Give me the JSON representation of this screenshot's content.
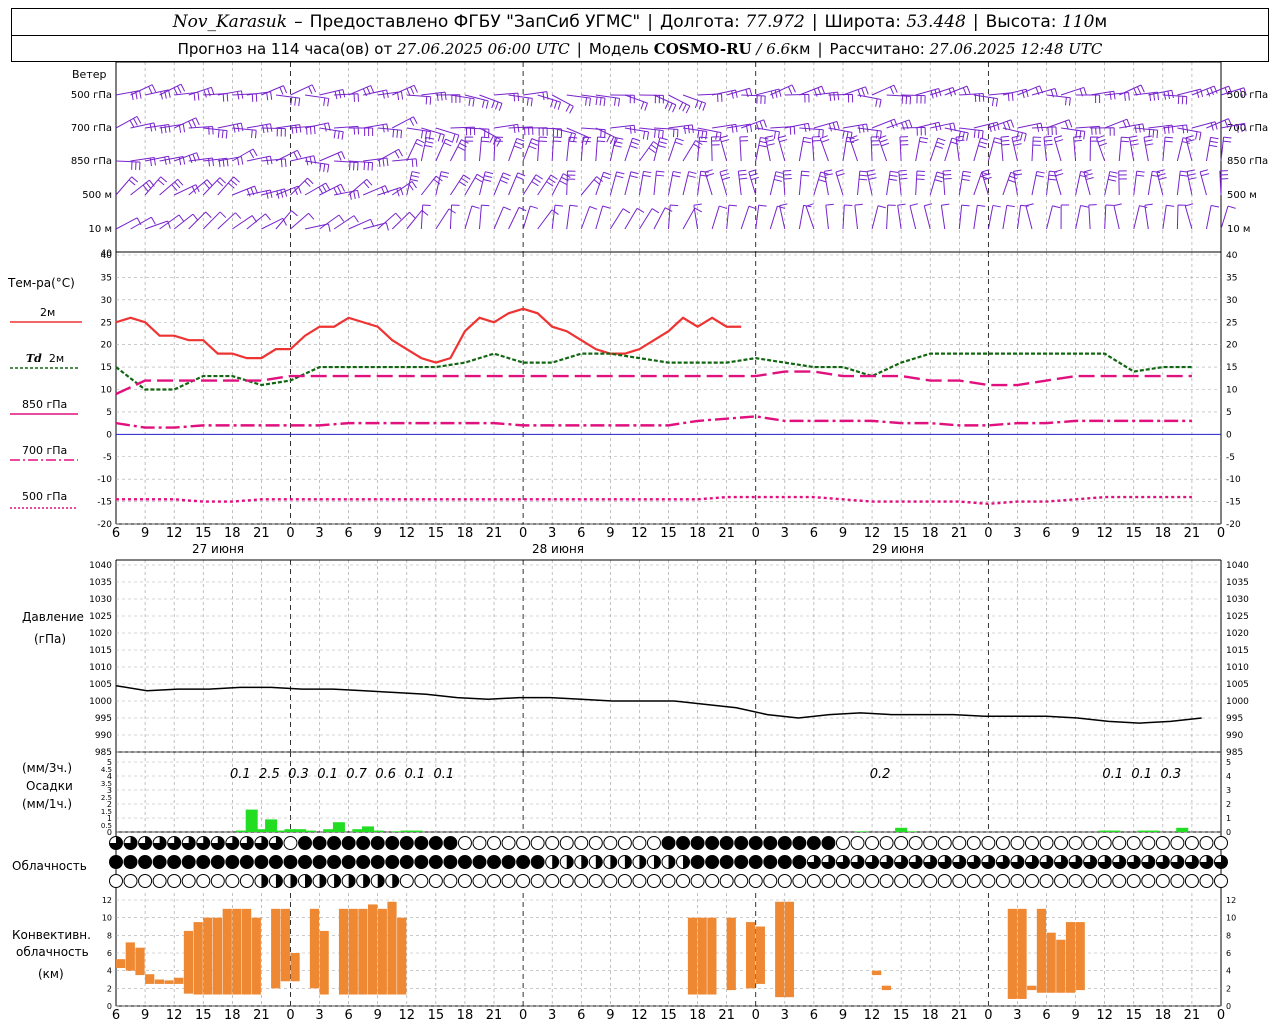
{
  "header": {
    "station": "Nov_Karasuk",
    "provider": "Предоставлено ФГБУ \"ЗапСиб УГМС\"",
    "longitude_label": "Долгота:",
    "longitude": "77.972",
    "latitude_label": "Широта:",
    "latitude": "53.448",
    "altitude_label": "Высота:",
    "altitude": "110",
    "altitude_unit": "м",
    "forecast_label": "Прогноз на 114 часа(ов) от",
    "forecast_start": "27.06.2025 06:00 UTC",
    "model_label": "Модель",
    "model": "COSMO-RU",
    "resolution": "/ 6.6",
    "resolution_unit": "км",
    "computed_label": "Рассчитано:",
    "computed": "27.06.2025 12:48 UTC"
  },
  "labels": {
    "wind": "Ветер",
    "wind_levels": [
      "500 гПа",
      "700 гПа",
      "850 гПа",
      "500 м",
      "10 м"
    ],
    "temp": "Тем-ра(°С)",
    "t2m": "2м",
    "td_italic": "Td",
    "td_rest": "2м",
    "t850": "850 гПа",
    "t700": "700 гПа",
    "t500": "500 гПа",
    "pressure": "Давление",
    "pressure_unit": "(гПа)",
    "precip_unit1": "(мм/3ч.)",
    "precip": "Осадки",
    "precip_unit2": "(мм/1ч.)",
    "clouds": "Облачность",
    "conv1": "Конвективн.",
    "conv2": "облачность",
    "conv3": "(км)"
  },
  "colors": {
    "t2m": "#ee3333",
    "td": "#116611",
    "t850": "#e0117f",
    "t700": "#e0117f",
    "t500": "#e0117f",
    "wind": "#7722cc",
    "zero_line": "#2222cc",
    "pressure": "#000000",
    "precip": "#22dd22",
    "conv": "#ee8833"
  },
  "chart_data": [
    {
      "type": "line",
      "title": "Тем-ра(°С)",
      "x_hours": [
        0,
        3,
        6,
        9,
        12,
        15,
        18,
        21,
        24,
        27,
        30,
        33,
        36,
        39,
        42,
        45,
        48,
        51,
        54,
        57,
        60,
        63,
        66,
        69,
        72,
        75,
        78,
        81,
        84,
        87,
        90,
        93,
        96,
        99,
        102,
        105,
        108,
        111,
        114
      ],
      "x_tick_labels": [
        "6",
        "9",
        "12",
        "15",
        "18",
        "21",
        "0",
        "3",
        "6",
        "9",
        "12",
        "15",
        "18",
        "21",
        "0",
        "3",
        "6",
        "9",
        "12",
        "15",
        "18",
        "21",
        "0",
        "3",
        "6",
        "9",
        "12",
        "15",
        "18",
        "21",
        "0",
        "3",
        "6",
        "9",
        "12",
        "15",
        "18",
        "21",
        "0",
        "3",
        "6",
        "9",
        "12"
      ],
      "date_labels": [
        "27 июня",
        "28 июня",
        "29 июня"
      ],
      "ylim": [
        -20,
        40
      ],
      "series": [
        {
          "name": "2м",
          "values": [
            25,
            26,
            25,
            22,
            22,
            21,
            21,
            18,
            18,
            17,
            17,
            19,
            19,
            22,
            24,
            24,
            26,
            25,
            24,
            21,
            19,
            17,
            16,
            17,
            23,
            26,
            25,
            27,
            28,
            27,
            24,
            23,
            21,
            19,
            18,
            18,
            19,
            21,
            23,
            26,
            24,
            26,
            24,
            24
          ],
          "dx": 1.5
        },
        {
          "name": "Td 2м",
          "values": [
            15,
            10,
            10,
            13,
            13,
            11,
            12,
            15,
            15,
            15,
            15,
            15,
            16,
            18,
            16,
            16,
            18,
            18,
            17,
            16,
            16,
            16,
            17,
            16,
            15,
            15,
            13,
            16,
            18,
            18,
            18,
            18,
            18,
            18,
            18,
            14,
            15,
            15
          ],
          "dx": 3
        },
        {
          "name": "850 гПа",
          "values": [
            9,
            12,
            12,
            12,
            12,
            12,
            13,
            13,
            13,
            13,
            13,
            13,
            13,
            13,
            13,
            13,
            13,
            13,
            13,
            13,
            13,
            13,
            13,
            14,
            14,
            13,
            13,
            13,
            12,
            12,
            11,
            11,
            12,
            13,
            13,
            13,
            13,
            13
          ],
          "dx": 3
        },
        {
          "name": "700 гПа",
          "values": [
            2.5,
            1.5,
            1.5,
            2,
            2,
            2,
            2,
            2,
            2.5,
            2.5,
            2.5,
            2.5,
            2.5,
            2.5,
            2,
            2,
            2,
            2,
            2,
            2,
            3,
            3.5,
            4,
            3,
            3,
            3,
            3,
            2.5,
            2.5,
            2,
            2,
            2.5,
            2.5,
            3,
            3,
            3,
            3,
            3
          ],
          "dx": 3
        },
        {
          "name": "500 гПа",
          "values": [
            -14.5,
            -14.5,
            -14.5,
            -15,
            -15,
            -14.5,
            -14.5,
            -14.5,
            -14.5,
            -14.5,
            -14.5,
            -14.5,
            -14.5,
            -14.5,
            -14.5,
            -14.5,
            -14.5,
            -14.5,
            -14.5,
            -14.5,
            -14.5,
            -14,
            -14,
            -14,
            -14,
            -14.5,
            -15,
            -15,
            -15,
            -15,
            -15.5,
            -15,
            -15,
            -14.5,
            -14,
            -14,
            -14,
            -14
          ],
          "dx": 3
        }
      ]
    },
    {
      "type": "line",
      "title": "Давление",
      "ylabel": "(гПа)",
      "ylim": [
        985,
        1040
      ],
      "series": [
        {
          "name": "Давление",
          "values": [
            1004.5,
            1003,
            1003.5,
            1003.5,
            1004,
            1004,
            1003.5,
            1003.5,
            1003,
            1002.5,
            1002,
            1001,
            1000.5,
            1001,
            1001,
            1000.5,
            1000,
            1000,
            1000,
            999,
            998,
            996,
            995,
            996,
            996.5,
            996,
            996,
            996,
            995.5,
            995.5,
            995.5,
            995,
            994,
            993.5,
            994,
            995
          ],
          "dx": 3.2
        }
      ]
    },
    {
      "type": "bar",
      "title": "Осадки",
      "ylabel": "(мм/1ч.)",
      "ylim": [
        0,
        5
      ],
      "precip_3h_labels": [
        {
          "hour": 12,
          "text": "0.1"
        },
        {
          "hour": 15,
          "text": "2.5"
        },
        {
          "hour": 18,
          "text": "0.3"
        },
        {
          "hour": 21,
          "text": "0.1"
        },
        {
          "hour": 24,
          "text": "0.7"
        },
        {
          "hour": 27,
          "text": "0.6"
        },
        {
          "hour": 30,
          "text": "0.1"
        },
        {
          "hour": 33,
          "text": "0.1"
        },
        {
          "hour": 78,
          "text": "0.2"
        },
        {
          "hour": 102,
          "text": "0.1"
        },
        {
          "hour": 105,
          "text": "0.1"
        },
        {
          "hour": 108,
          "text": "0.3"
        }
      ],
      "bars": [
        {
          "hour": 13,
          "value": 0.1
        },
        {
          "hour": 14,
          "value": 1.6
        },
        {
          "hour": 15,
          "value": 0.2
        },
        {
          "hour": 16,
          "value": 0.9
        },
        {
          "hour": 17,
          "value": 0.1
        },
        {
          "hour": 18,
          "value": 0.2
        },
        {
          "hour": 19,
          "value": 0.2
        },
        {
          "hour": 20,
          "value": 0.1
        },
        {
          "hour": 22,
          "value": 0.2
        },
        {
          "hour": 23,
          "value": 0.7
        },
        {
          "hour": 25,
          "value": 0.2
        },
        {
          "hour": 26,
          "value": 0.4
        },
        {
          "hour": 27,
          "value": 0.1
        },
        {
          "hour": 29,
          "value": 0.05
        },
        {
          "hour": 30,
          "value": 0.1
        },
        {
          "hour": 31,
          "value": 0.1
        },
        {
          "hour": 77,
          "value": 0.05
        },
        {
          "hour": 81,
          "value": 0.3
        },
        {
          "hour": 82,
          "value": 0.05
        },
        {
          "hour": 102,
          "value": 0.1
        },
        {
          "hour": 103,
          "value": 0.1
        },
        {
          "hour": 106,
          "value": 0.1
        },
        {
          "hour": 107,
          "value": 0.1
        },
        {
          "hour": 110,
          "value": 0.3
        }
      ]
    },
    {
      "type": "bar",
      "title": "Конвективн. облачность",
      "ylabel": "(км)",
      "ylim": [
        0,
        12
      ],
      "ranges": [
        {
          "hour": 0,
          "bottom": 4.3,
          "top": 5.3
        },
        {
          "hour": 1,
          "bottom": 4.0,
          "top": 7.2
        },
        {
          "hour": 2,
          "bottom": 3.5,
          "top": 6.6
        },
        {
          "hour": 3,
          "bottom": 2.5,
          "top": 3.6
        },
        {
          "hour": 4,
          "bottom": 2.5,
          "top": 3.0
        },
        {
          "hour": 5,
          "bottom": 2.5,
          "top": 2.9
        },
        {
          "hour": 6,
          "bottom": 2.5,
          "top": 3.2
        },
        {
          "hour": 7,
          "bottom": 1.4,
          "top": 8.5
        },
        {
          "hour": 8,
          "bottom": 1.3,
          "top": 9.5
        },
        {
          "hour": 9,
          "bottom": 1.3,
          "top": 10
        },
        {
          "hour": 10,
          "bottom": 1.3,
          "top": 10
        },
        {
          "hour": 11,
          "bottom": 1.3,
          "top": 11
        },
        {
          "hour": 12,
          "bottom": 1.3,
          "top": 11
        },
        {
          "hour": 13,
          "bottom": 1.3,
          "top": 11
        },
        {
          "hour": 14,
          "bottom": 1.3,
          "top": 10
        },
        {
          "hour": 16,
          "bottom": 2.0,
          "top": 11
        },
        {
          "hour": 17,
          "bottom": 2.8,
          "top": 11
        },
        {
          "hour": 18,
          "bottom": 2.8,
          "top": 6.0
        },
        {
          "hour": 20,
          "bottom": 2.0,
          "top": 11
        },
        {
          "hour": 21,
          "bottom": 1.3,
          "top": 8.5
        },
        {
          "hour": 23,
          "bottom": 1.3,
          "top": 11
        },
        {
          "hour": 24,
          "bottom": 1.3,
          "top": 11
        },
        {
          "hour": 25,
          "bottom": 1.3,
          "top": 11
        },
        {
          "hour": 26,
          "bottom": 1.3,
          "top": 11.5
        },
        {
          "hour": 27,
          "bottom": 1.3,
          "top": 11
        },
        {
          "hour": 28,
          "bottom": 1.3,
          "top": 11.8
        },
        {
          "hour": 29,
          "bottom": 1.3,
          "top": 10
        },
        {
          "hour": 59,
          "bottom": 1.3,
          "top": 10
        },
        {
          "hour": 60,
          "bottom": 1.3,
          "top": 10
        },
        {
          "hour": 61,
          "bottom": 1.3,
          "top": 10
        },
        {
          "hour": 63,
          "bottom": 1.8,
          "top": 10
        },
        {
          "hour": 65,
          "bottom": 2.0,
          "top": 9.5
        },
        {
          "hour": 66,
          "bottom": 2.5,
          "top": 9.0
        },
        {
          "hour": 68,
          "bottom": 1.0,
          "top": 11.8
        },
        {
          "hour": 69,
          "bottom": 1.0,
          "top": 11.8
        },
        {
          "hour": 78,
          "bottom": 3.5,
          "top": 4.0
        },
        {
          "hour": 79,
          "bottom": 1.8,
          "top": 2.3
        },
        {
          "hour": 92,
          "bottom": 0.8,
          "top": 11
        },
        {
          "hour": 93,
          "bottom": 0.8,
          "top": 11
        },
        {
          "hour": 94,
          "bottom": 1.8,
          "top": 2.3
        },
        {
          "hour": 95,
          "bottom": 1.5,
          "top": 11
        },
        {
          "hour": 96,
          "bottom": 1.5,
          "top": 8.3
        },
        {
          "hour": 97,
          "bottom": 1.5,
          "top": 7.5
        },
        {
          "hour": 98,
          "bottom": 1.5,
          "top": 9.5
        },
        {
          "hour": 99,
          "bottom": 1.8,
          "top": 9.5
        }
      ]
    }
  ]
}
